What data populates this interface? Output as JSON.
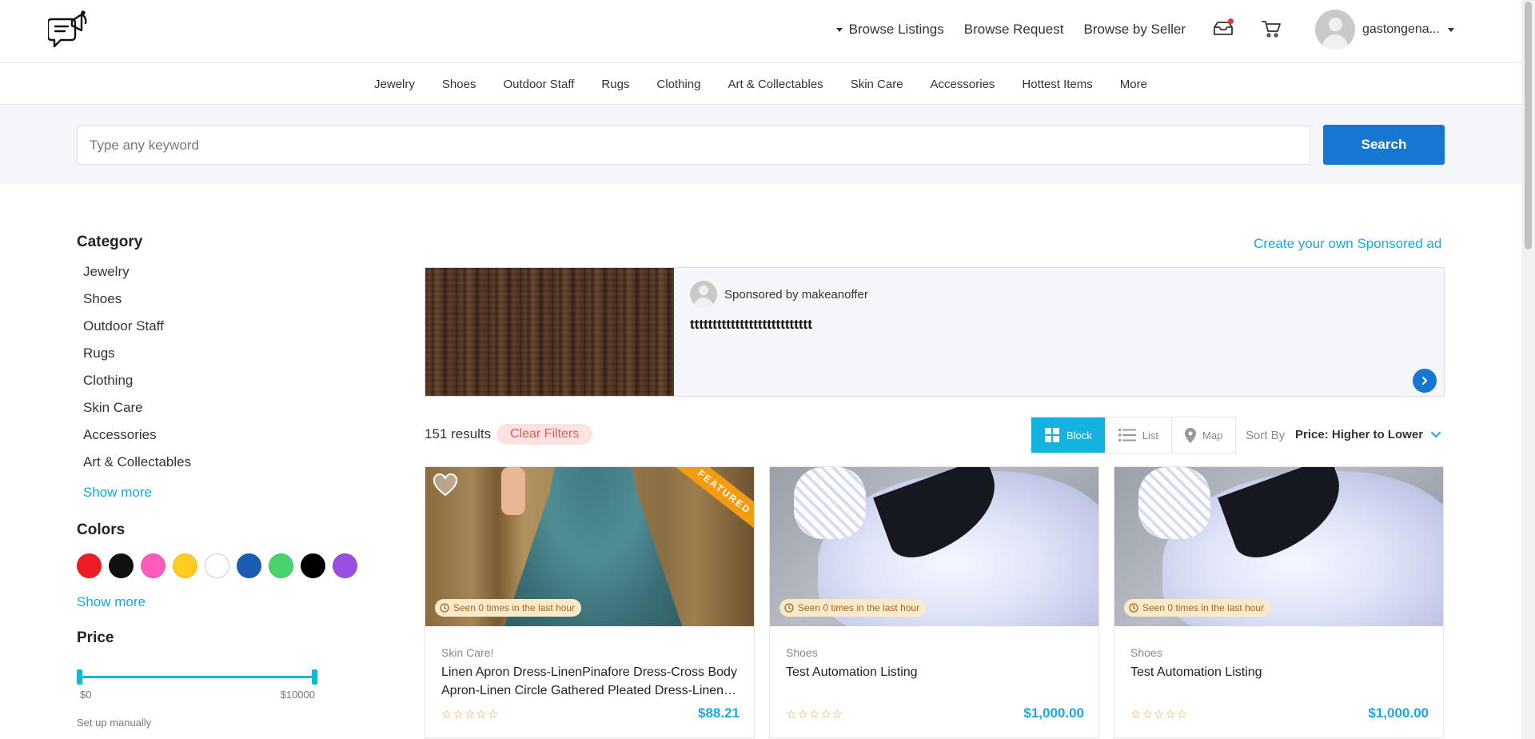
{
  "header": {
    "nav": [
      "Browse Listings",
      "Browse Request",
      "Browse by Seller"
    ],
    "username": "gastongena...",
    "icons": [
      "logo-megaphone-chat-icon",
      "inbox-icon",
      "cart-icon",
      "avatar"
    ]
  },
  "categories_bar": [
    "Jewelry",
    "Shoes",
    "Outdoor Staff",
    "Rugs",
    "Clothing",
    "Art & Collectables",
    "Skin Care",
    "Accessories",
    "Hottest Items",
    "More"
  ],
  "search": {
    "placeholder": "Type any keyword",
    "button": "Search"
  },
  "sidebar": {
    "category_title": "Category",
    "categories": [
      "Jewelry",
      "Shoes",
      "Outdoor Staff",
      "Rugs",
      "Clothing",
      "Skin Care",
      "Accessories",
      "Art & Collectables"
    ],
    "show_more": "Show more",
    "colors_title": "Colors",
    "colors": [
      "#ee1c25",
      "#111111",
      "#ff5bbd",
      "#ffcc22",
      "#ffffff",
      "#1c5db4",
      "#49d26b",
      "#000000",
      "#9b4fe0"
    ],
    "colors_show_more": "Show more",
    "price_title": "Price",
    "price_min": "$0",
    "price_max": "$10000",
    "manual_label": "Set up manually"
  },
  "sponsored": {
    "create_link": "Create your own Sponsored ad",
    "by": "Sponsored by makeanoffer",
    "text": "ttttttttttttttttttttttttttt"
  },
  "results": {
    "count": "151 results",
    "clear": "Clear Filters",
    "views": [
      "Block",
      "List",
      "Map"
    ],
    "active_view": "Block",
    "sort_label": "Sort By",
    "sort_value": "Price: Higher to Lower"
  },
  "listings": [
    {
      "category": "Skin Care!",
      "title": "Linen Apron Dress-LinenPinafore Dress-Cross Body Apron-Linen Circle Gathered Pleated Dress-Linen Dress",
      "price": "$88.21",
      "seen": "Seen 0 times in the last hour",
      "featured": "FEATURED"
    },
    {
      "category": "Shoes",
      "title": "Test Automation Listing",
      "price": "$1,000.00",
      "seen": "Seen 0 times in the last hour"
    },
    {
      "category": "Shoes",
      "title": "Test Automation Listing",
      "price": "$1,000.00",
      "seen": "Seen 0 times in the last hour"
    }
  ]
}
